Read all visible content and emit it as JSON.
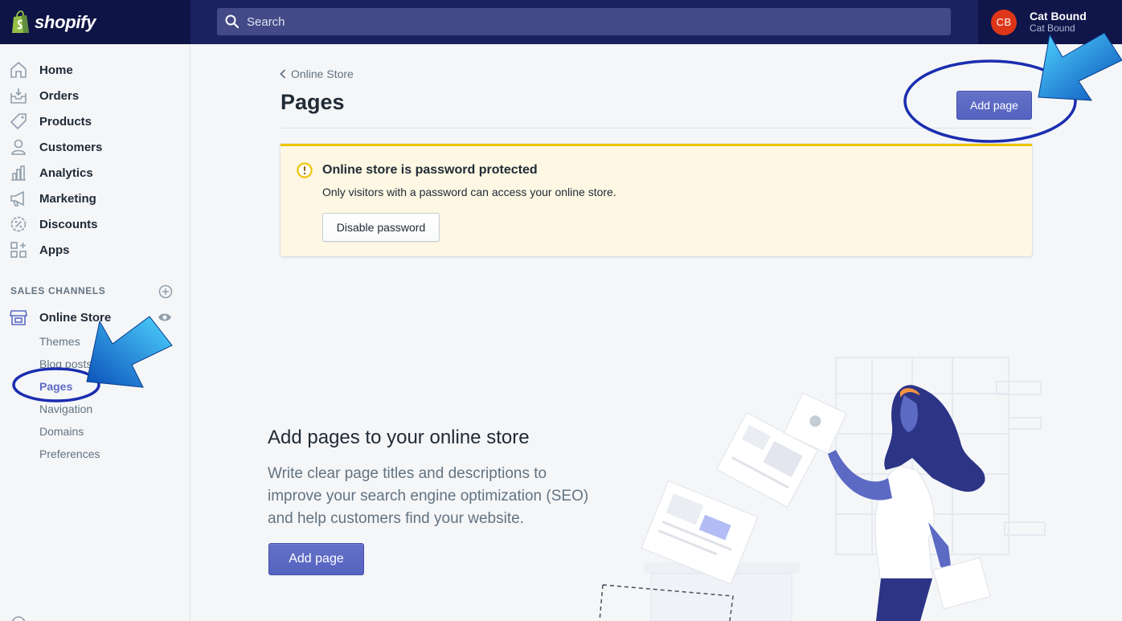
{
  "topbar": {
    "brand": "shopify",
    "search_placeholder": "Search",
    "user": {
      "initials": "CB",
      "name": "Cat Bound",
      "store": "Cat Bound"
    }
  },
  "sidebar": {
    "items": [
      {
        "label": "Home",
        "icon": "home-icon"
      },
      {
        "label": "Orders",
        "icon": "orders-icon"
      },
      {
        "label": "Products",
        "icon": "tag-icon"
      },
      {
        "label": "Customers",
        "icon": "person-icon"
      },
      {
        "label": "Analytics",
        "icon": "bar-chart-icon"
      },
      {
        "label": "Marketing",
        "icon": "megaphone-icon"
      },
      {
        "label": "Discounts",
        "icon": "discount-icon"
      },
      {
        "label": "Apps",
        "icon": "apps-icon"
      }
    ],
    "section_title": "SALES CHANNELS",
    "channel": {
      "label": "Online Store"
    },
    "sub_items": [
      "Themes",
      "Blog posts",
      "Pages",
      "Navigation",
      "Domains",
      "Preferences"
    ],
    "active_sub": "Pages"
  },
  "main": {
    "breadcrumb": "Online Store",
    "title": "Pages",
    "add_button": "Add page",
    "banner": {
      "title": "Online store is password protected",
      "text": "Only visitors with a password can access your online store.",
      "button": "Disable password"
    },
    "empty_state": {
      "title": "Add pages to your online store",
      "text": "Write clear page titles and descriptions to improve your search engine optimization (SEO) and help customers find your website.",
      "button": "Add page"
    }
  },
  "colors": {
    "topbar": "#1c2260",
    "accent": "#5c6ac4",
    "banner_border": "#eec200",
    "annotation_blue": "#1a2db0"
  }
}
